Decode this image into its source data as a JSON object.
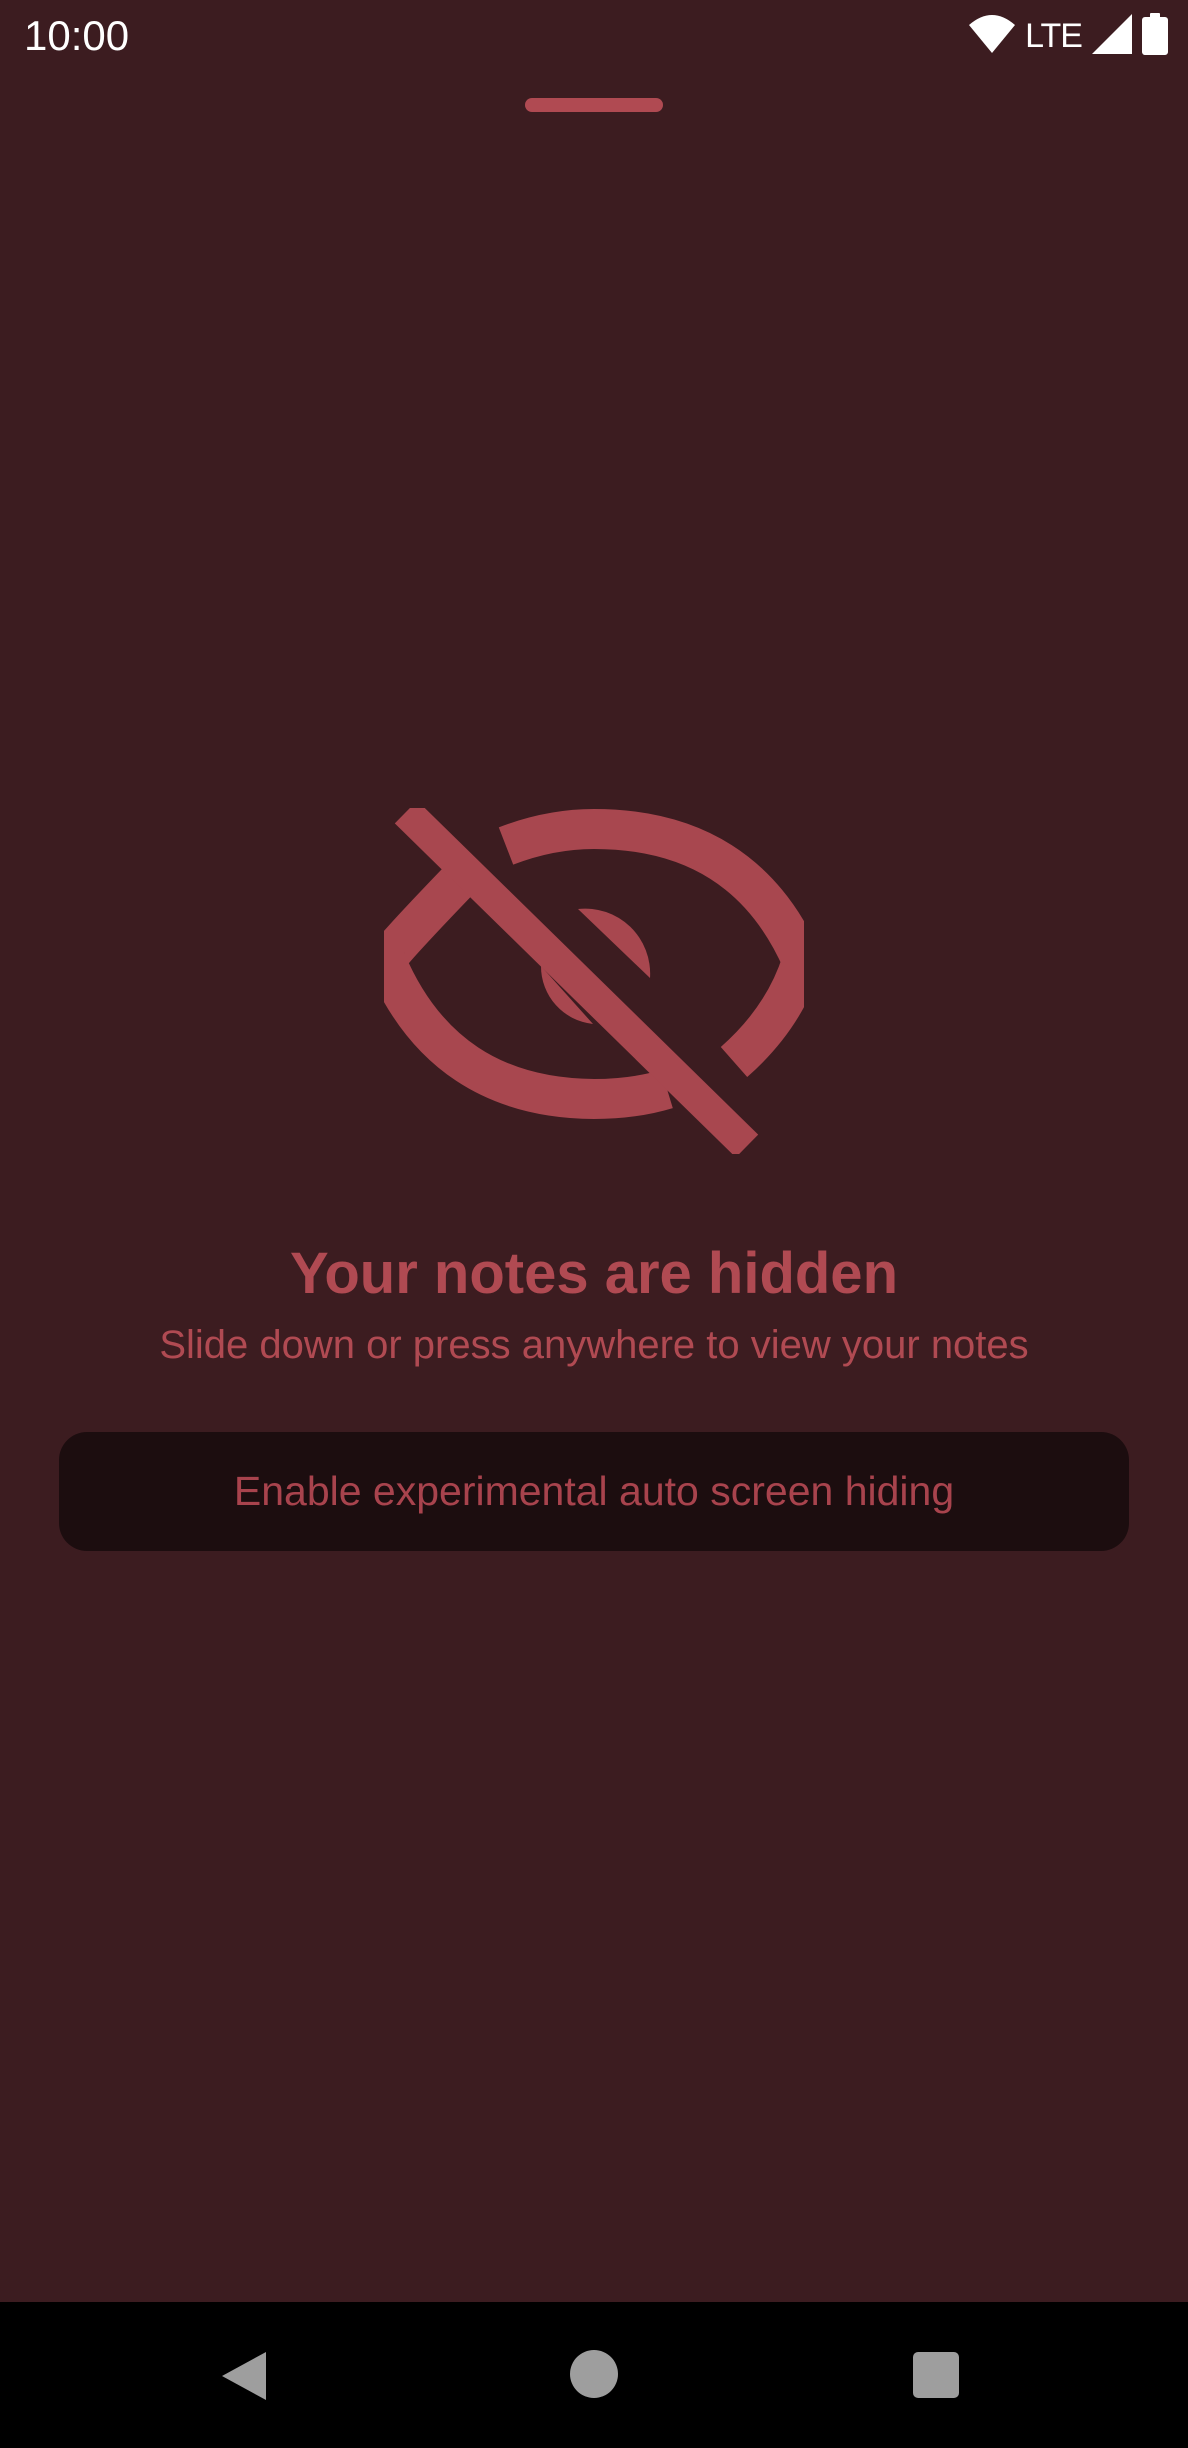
{
  "status_bar": {
    "time": "10:00",
    "network": "LTE",
    "icons": [
      "wifi-icon",
      "cell-signal-icon",
      "battery-icon"
    ]
  },
  "bottom_sheet": {
    "handle": "drag-handle"
  },
  "hidden_notice": {
    "icon": "eye-off-icon",
    "title": "Your notes are hidden",
    "subtitle": "Slide down or press anywhere to view your notes"
  },
  "experimental_button": {
    "label": "Enable experimental auto screen hiding"
  },
  "nav_bar": {
    "buttons": [
      "back-icon",
      "home-icon",
      "recents-icon"
    ]
  },
  "colors": {
    "background": "#3c1c20",
    "accent": "#b04a52",
    "button_background": "#1c0d0f",
    "button_text": "#a8434d",
    "nav_background": "#000000"
  }
}
